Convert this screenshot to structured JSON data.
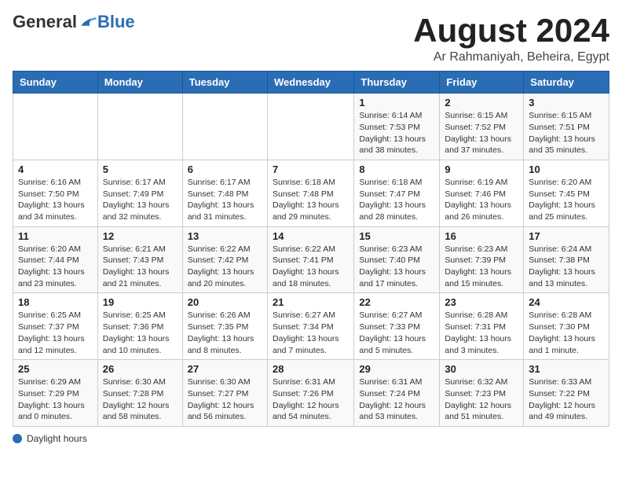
{
  "header": {
    "logo_general": "General",
    "logo_blue": "Blue",
    "title": "August 2024",
    "subtitle": "Ar Rahmaniyah, Beheira, Egypt"
  },
  "calendar": {
    "days_of_week": [
      "Sunday",
      "Monday",
      "Tuesday",
      "Wednesday",
      "Thursday",
      "Friday",
      "Saturday"
    ],
    "weeks": [
      [
        {
          "day": "",
          "info": ""
        },
        {
          "day": "",
          "info": ""
        },
        {
          "day": "",
          "info": ""
        },
        {
          "day": "",
          "info": ""
        },
        {
          "day": "1",
          "info": "Sunrise: 6:14 AM\nSunset: 7:53 PM\nDaylight: 13 hours\nand 38 minutes."
        },
        {
          "day": "2",
          "info": "Sunrise: 6:15 AM\nSunset: 7:52 PM\nDaylight: 13 hours\nand 37 minutes."
        },
        {
          "day": "3",
          "info": "Sunrise: 6:15 AM\nSunset: 7:51 PM\nDaylight: 13 hours\nand 35 minutes."
        }
      ],
      [
        {
          "day": "4",
          "info": "Sunrise: 6:16 AM\nSunset: 7:50 PM\nDaylight: 13 hours\nand 34 minutes."
        },
        {
          "day": "5",
          "info": "Sunrise: 6:17 AM\nSunset: 7:49 PM\nDaylight: 13 hours\nand 32 minutes."
        },
        {
          "day": "6",
          "info": "Sunrise: 6:17 AM\nSunset: 7:48 PM\nDaylight: 13 hours\nand 31 minutes."
        },
        {
          "day": "7",
          "info": "Sunrise: 6:18 AM\nSunset: 7:48 PM\nDaylight: 13 hours\nand 29 minutes."
        },
        {
          "day": "8",
          "info": "Sunrise: 6:18 AM\nSunset: 7:47 PM\nDaylight: 13 hours\nand 28 minutes."
        },
        {
          "day": "9",
          "info": "Sunrise: 6:19 AM\nSunset: 7:46 PM\nDaylight: 13 hours\nand 26 minutes."
        },
        {
          "day": "10",
          "info": "Sunrise: 6:20 AM\nSunset: 7:45 PM\nDaylight: 13 hours\nand 25 minutes."
        }
      ],
      [
        {
          "day": "11",
          "info": "Sunrise: 6:20 AM\nSunset: 7:44 PM\nDaylight: 13 hours\nand 23 minutes."
        },
        {
          "day": "12",
          "info": "Sunrise: 6:21 AM\nSunset: 7:43 PM\nDaylight: 13 hours\nand 21 minutes."
        },
        {
          "day": "13",
          "info": "Sunrise: 6:22 AM\nSunset: 7:42 PM\nDaylight: 13 hours\nand 20 minutes."
        },
        {
          "day": "14",
          "info": "Sunrise: 6:22 AM\nSunset: 7:41 PM\nDaylight: 13 hours\nand 18 minutes."
        },
        {
          "day": "15",
          "info": "Sunrise: 6:23 AM\nSunset: 7:40 PM\nDaylight: 13 hours\nand 17 minutes."
        },
        {
          "day": "16",
          "info": "Sunrise: 6:23 AM\nSunset: 7:39 PM\nDaylight: 13 hours\nand 15 minutes."
        },
        {
          "day": "17",
          "info": "Sunrise: 6:24 AM\nSunset: 7:38 PM\nDaylight: 13 hours\nand 13 minutes."
        }
      ],
      [
        {
          "day": "18",
          "info": "Sunrise: 6:25 AM\nSunset: 7:37 PM\nDaylight: 13 hours\nand 12 minutes."
        },
        {
          "day": "19",
          "info": "Sunrise: 6:25 AM\nSunset: 7:36 PM\nDaylight: 13 hours\nand 10 minutes."
        },
        {
          "day": "20",
          "info": "Sunrise: 6:26 AM\nSunset: 7:35 PM\nDaylight: 13 hours\nand 8 minutes."
        },
        {
          "day": "21",
          "info": "Sunrise: 6:27 AM\nSunset: 7:34 PM\nDaylight: 13 hours\nand 7 minutes."
        },
        {
          "day": "22",
          "info": "Sunrise: 6:27 AM\nSunset: 7:33 PM\nDaylight: 13 hours\nand 5 minutes."
        },
        {
          "day": "23",
          "info": "Sunrise: 6:28 AM\nSunset: 7:31 PM\nDaylight: 13 hours\nand 3 minutes."
        },
        {
          "day": "24",
          "info": "Sunrise: 6:28 AM\nSunset: 7:30 PM\nDaylight: 13 hours\nand 1 minute."
        }
      ],
      [
        {
          "day": "25",
          "info": "Sunrise: 6:29 AM\nSunset: 7:29 PM\nDaylight: 13 hours\nand 0 minutes."
        },
        {
          "day": "26",
          "info": "Sunrise: 6:30 AM\nSunset: 7:28 PM\nDaylight: 12 hours\nand 58 minutes."
        },
        {
          "day": "27",
          "info": "Sunrise: 6:30 AM\nSunset: 7:27 PM\nDaylight: 12 hours\nand 56 minutes."
        },
        {
          "day": "28",
          "info": "Sunrise: 6:31 AM\nSunset: 7:26 PM\nDaylight: 12 hours\nand 54 minutes."
        },
        {
          "day": "29",
          "info": "Sunrise: 6:31 AM\nSunset: 7:24 PM\nDaylight: 12 hours\nand 53 minutes."
        },
        {
          "day": "30",
          "info": "Sunrise: 6:32 AM\nSunset: 7:23 PM\nDaylight: 12 hours\nand 51 minutes."
        },
        {
          "day": "31",
          "info": "Sunrise: 6:33 AM\nSunset: 7:22 PM\nDaylight: 12 hours\nand 49 minutes."
        }
      ]
    ]
  },
  "footer": {
    "label": "Daylight hours"
  }
}
